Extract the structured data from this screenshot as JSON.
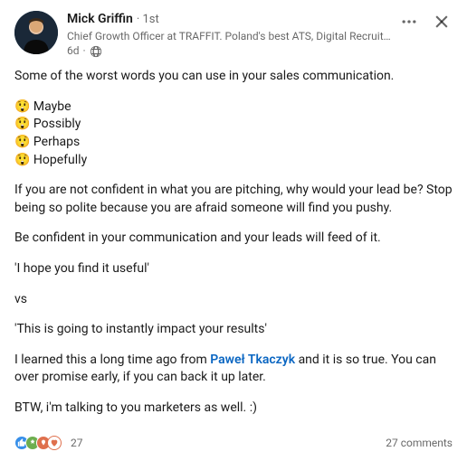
{
  "author": {
    "name": "Mick Griffin",
    "degree": "· 1st",
    "headline": "Chief Growth Officer at TRAFFIT. Poland's best ATS, Digital Recruit…",
    "time": "6d"
  },
  "content": {
    "intro": "Some of the worst words you can use in your sales communication.",
    "bullet_emoji": "😲",
    "bullets": {
      "b1": "Maybe",
      "b2": "Possibly",
      "b3": "Perhaps",
      "b4": "Hopefully"
    },
    "p1": "If you are not confident in what you are pitching, why would your lead be? Stop being so polite because you are afraid someone will find you pushy.",
    "p2": "Be confident in your communication and your leads will feed of it.",
    "p3": "'I hope you find it useful'",
    "p4": "vs",
    "p5": "'This is going to instantly impact your results'",
    "p6_a": "I learned this a long time ago from ",
    "p6_mention": "Paweł Tkaczyk",
    "p6_b": " and it is so true. You can over promise early, if you can back it up later.",
    "p7": "BTW, i'm talking to you marketers as well. :)"
  },
  "footer": {
    "reaction_count": "27",
    "comments": "27 comments"
  }
}
